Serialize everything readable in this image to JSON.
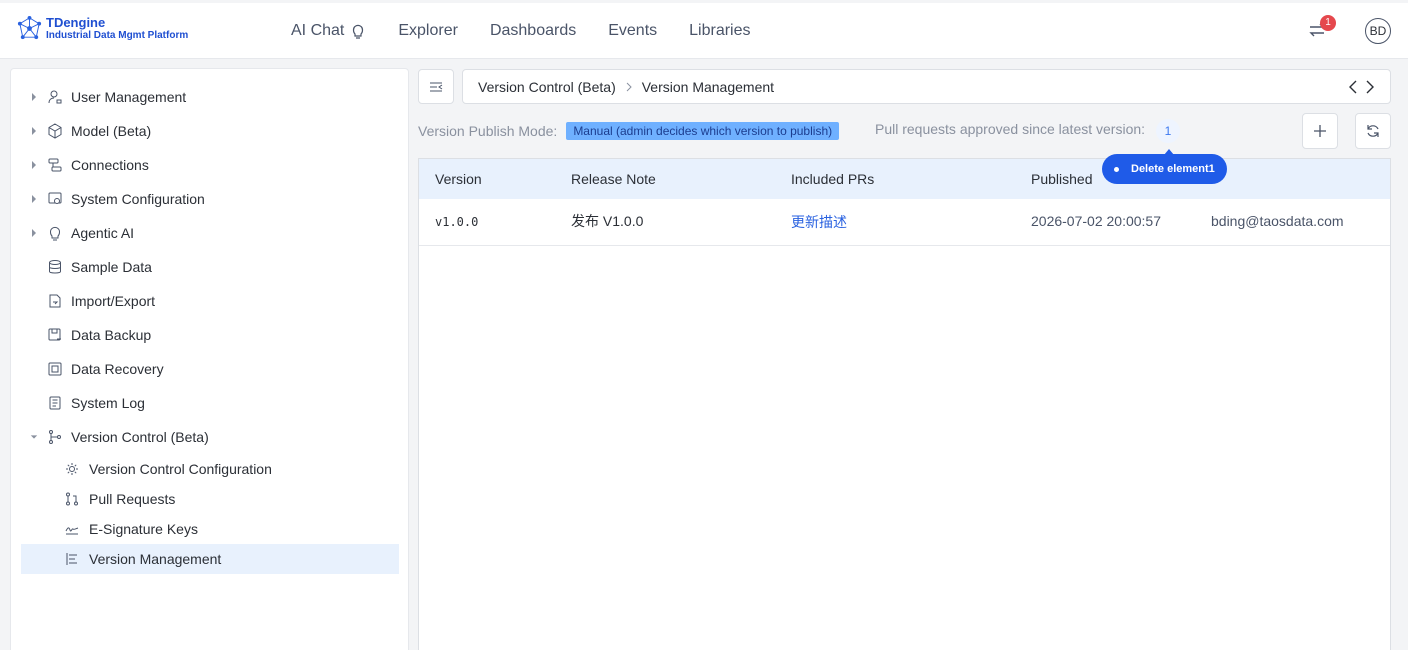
{
  "brand": {
    "title": "TDengine",
    "subtitle": "Industrial Data Mgmt Platform"
  },
  "nav": [
    {
      "label": "AI Chat",
      "icon": "lightbulb-icon"
    },
    {
      "label": "Explorer"
    },
    {
      "label": "Dashboards"
    },
    {
      "label": "Events"
    },
    {
      "label": "Libraries"
    }
  ],
  "header": {
    "notification_count": "1",
    "avatar_initials": "BD"
  },
  "sidebar": {
    "items": [
      {
        "label": "User Management",
        "icon": "user-lock-icon",
        "expandable": true
      },
      {
        "label": "Model (Beta)",
        "icon": "cube-icon",
        "expandable": true
      },
      {
        "label": "Connections",
        "icon": "connections-icon",
        "expandable": true
      },
      {
        "label": "System Configuration",
        "icon": "system-config-icon",
        "expandable": true
      },
      {
        "label": "Agentic AI",
        "icon": "lightbulb-icon",
        "expandable": true
      },
      {
        "label": "Sample Data",
        "icon": "database-icon"
      },
      {
        "label": "Import/Export",
        "icon": "import-export-icon"
      },
      {
        "label": "Data Backup",
        "icon": "backup-icon"
      },
      {
        "label": "Data Recovery",
        "icon": "recovery-icon"
      },
      {
        "label": "System Log",
        "icon": "log-icon"
      },
      {
        "label": "Version Control (Beta)",
        "icon": "branch-icon",
        "expanded": true
      }
    ],
    "subitems": [
      {
        "label": "Version Control Configuration",
        "icon": "gear-icon"
      },
      {
        "label": "Pull Requests",
        "icon": "pull-request-icon"
      },
      {
        "label": "E-Signature Keys",
        "icon": "signature-icon"
      },
      {
        "label": "Version Management",
        "icon": "list-icon",
        "active": true
      }
    ]
  },
  "breadcrumb": {
    "parent": "Version Control (Beta)",
    "current": "Version Management"
  },
  "publish": {
    "mode_label": "Version Publish Mode:",
    "mode_value": "Manual (admin decides which version to publish)",
    "approved_label": "Pull requests approved since latest version:",
    "approved_count": "1"
  },
  "table": {
    "columns": [
      "Version",
      "Release Note",
      "Included PRs",
      "Published"
    ],
    "rows": [
      {
        "version": "v1.0.0",
        "release_note": "发布 V1.0.0",
        "included_prs": "更新描述",
        "published": "2026-07-02 20:00:57",
        "published_by": "bding@taosdata.com"
      }
    ]
  },
  "tooltip": {
    "label": "Delete element1"
  }
}
